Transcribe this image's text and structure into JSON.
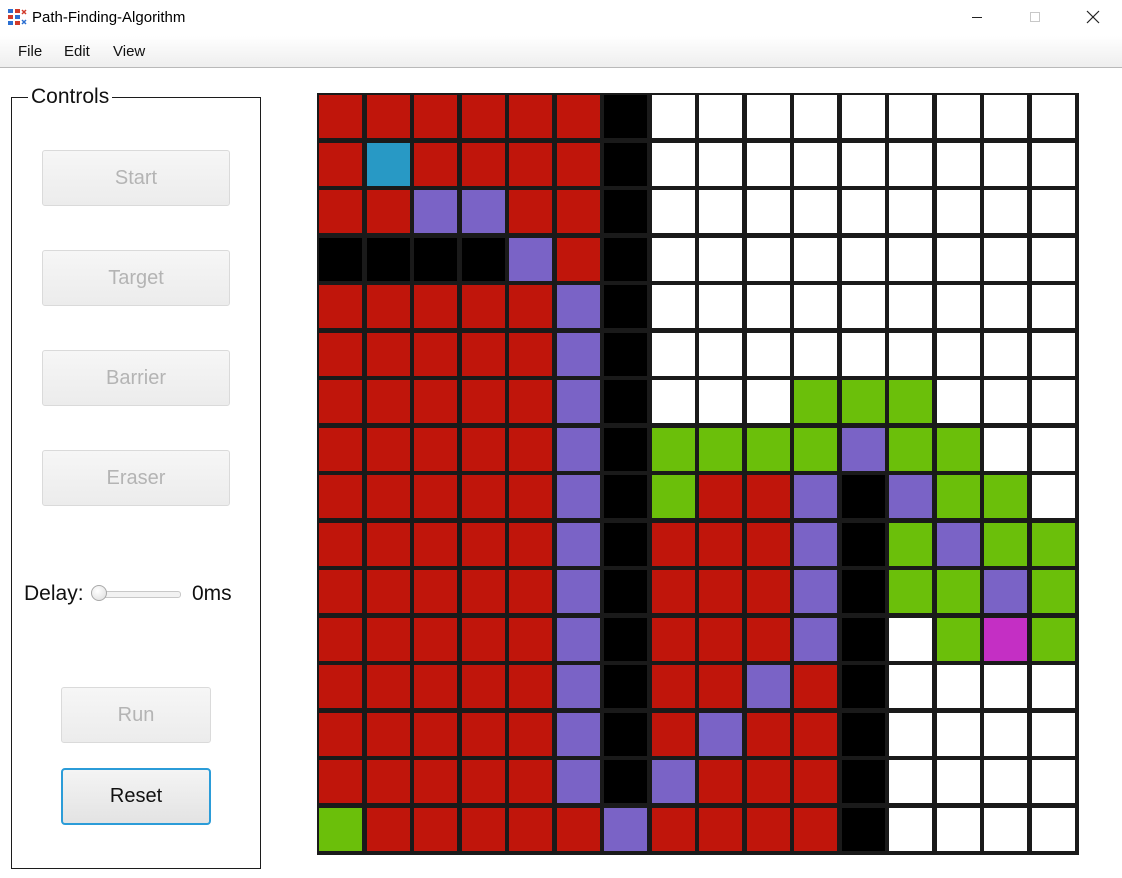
{
  "window": {
    "title": "Path-Finding-Algorithm",
    "icon": "app-grid-icon"
  },
  "menu": {
    "items": [
      "File",
      "Edit",
      "View"
    ]
  },
  "controls": {
    "title": "Controls",
    "start_label": "Start",
    "target_label": "Target",
    "barrier_label": "Barrier",
    "eraser_label": "Eraser",
    "delay_label": "Delay:",
    "delay_value": "0ms",
    "delay_slider_value": 0,
    "run_label": "Run",
    "reset_label": "Reset"
  },
  "grid": {
    "rows": 16,
    "cols": 16,
    "legend": {
      "W": {
        "state": "empty",
        "color": "#ffffff"
      },
      "R": {
        "state": "visited",
        "color": "#c0150b"
      },
      "B": {
        "state": "barrier",
        "color": "#000000"
      },
      "P": {
        "state": "path",
        "color": "#7a63c6"
      },
      "G": {
        "state": "frontier",
        "color": "#6bbf0a"
      },
      "S": {
        "state": "start",
        "color": "#2899c5"
      },
      "T": {
        "state": "target",
        "color": "#c42fc4"
      }
    },
    "cells": [
      "RRRRRRBWWWWWWWWW",
      "RSRRRRBWWWWWWWWW",
      "RRPPRRBWWWWWWWWW",
      "BBBBPRBWWWWWWWWW",
      "RRRRRPBWWWWWWWWW",
      "RRRRRPBWWWWWWWWW",
      "RRRRRPBWWWGGGWWW",
      "RRRRRPBGGGGPGGWW",
      "RRRRRPBGRRPBPGGW",
      "RRRRRPBRRRPBGPGG",
      "RRRRRPBRRRPBGGPG",
      "RRRRRPBRRRPBWGTG",
      "RRRRRPBRRPRBWWWW",
      "RRRRRPBRPRRBWWWW",
      "RRRRRPBPRRRBWWWW",
      "GRRRRRPRRRRBWWWW"
    ]
  }
}
